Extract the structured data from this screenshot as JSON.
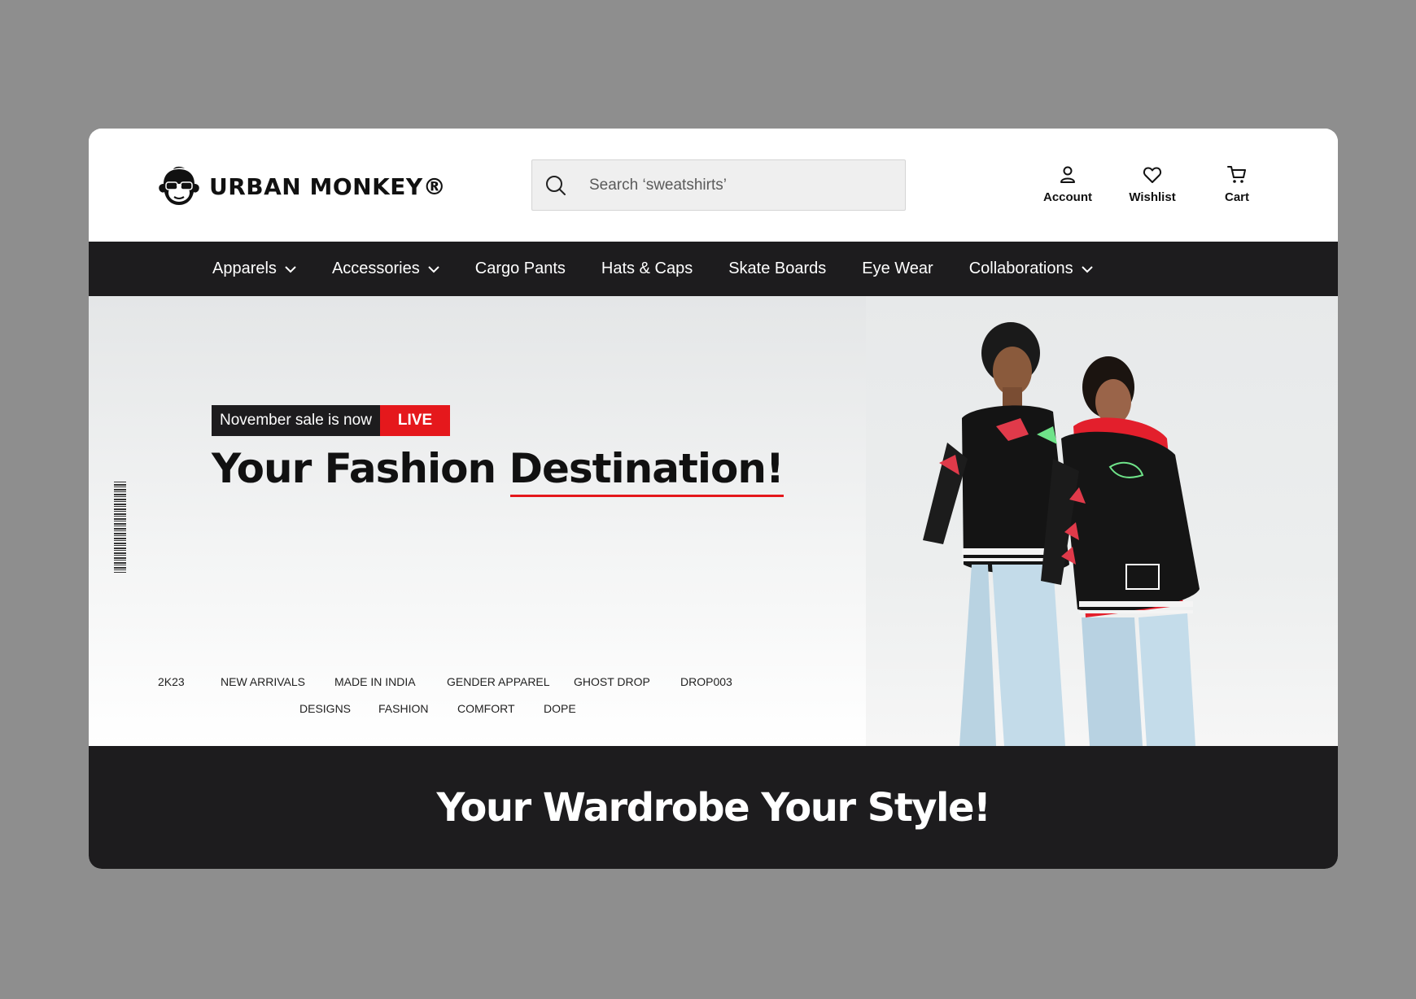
{
  "brand": {
    "name": "URBAN MONKEY®"
  },
  "search": {
    "placeholder": "Search ‘sweatshirts’"
  },
  "header_actions": [
    {
      "label": "Account",
      "icon": "user-icon"
    },
    {
      "label": "Wishlist",
      "icon": "heart-icon"
    },
    {
      "label": "Cart",
      "icon": "cart-icon"
    }
  ],
  "nav": [
    {
      "label": "Apparels",
      "dropdown": true
    },
    {
      "label": "Accessories",
      "dropdown": true
    },
    {
      "label": "Cargo Pants",
      "dropdown": false
    },
    {
      "label": "Hats & Caps",
      "dropdown": false
    },
    {
      "label": "Skate Boards",
      "dropdown": false
    },
    {
      "label": "Eye Wear",
      "dropdown": false
    },
    {
      "label": "Collaborations",
      "dropdown": true
    }
  ],
  "hero": {
    "sale_text": "November sale is now",
    "sale_live": "LIVE",
    "title_regular": "Your Fashion ",
    "title_bold": "Destination!",
    "tags_row1": [
      "2K23",
      "NEW ARRIVALS",
      "MADE IN INDIA",
      "GENDER APPAREL",
      "GHOST DROP",
      "DROP003"
    ],
    "tags_row2": [
      "DESIGNS",
      "FASHION",
      "COMFORT",
      "DOPE"
    ]
  },
  "band": {
    "title": "Your Wardrobe Your Style!"
  },
  "colors": {
    "accent": "#e5181c",
    "dark": "#1d1c1e",
    "backdrop": "#8e8e8e"
  }
}
